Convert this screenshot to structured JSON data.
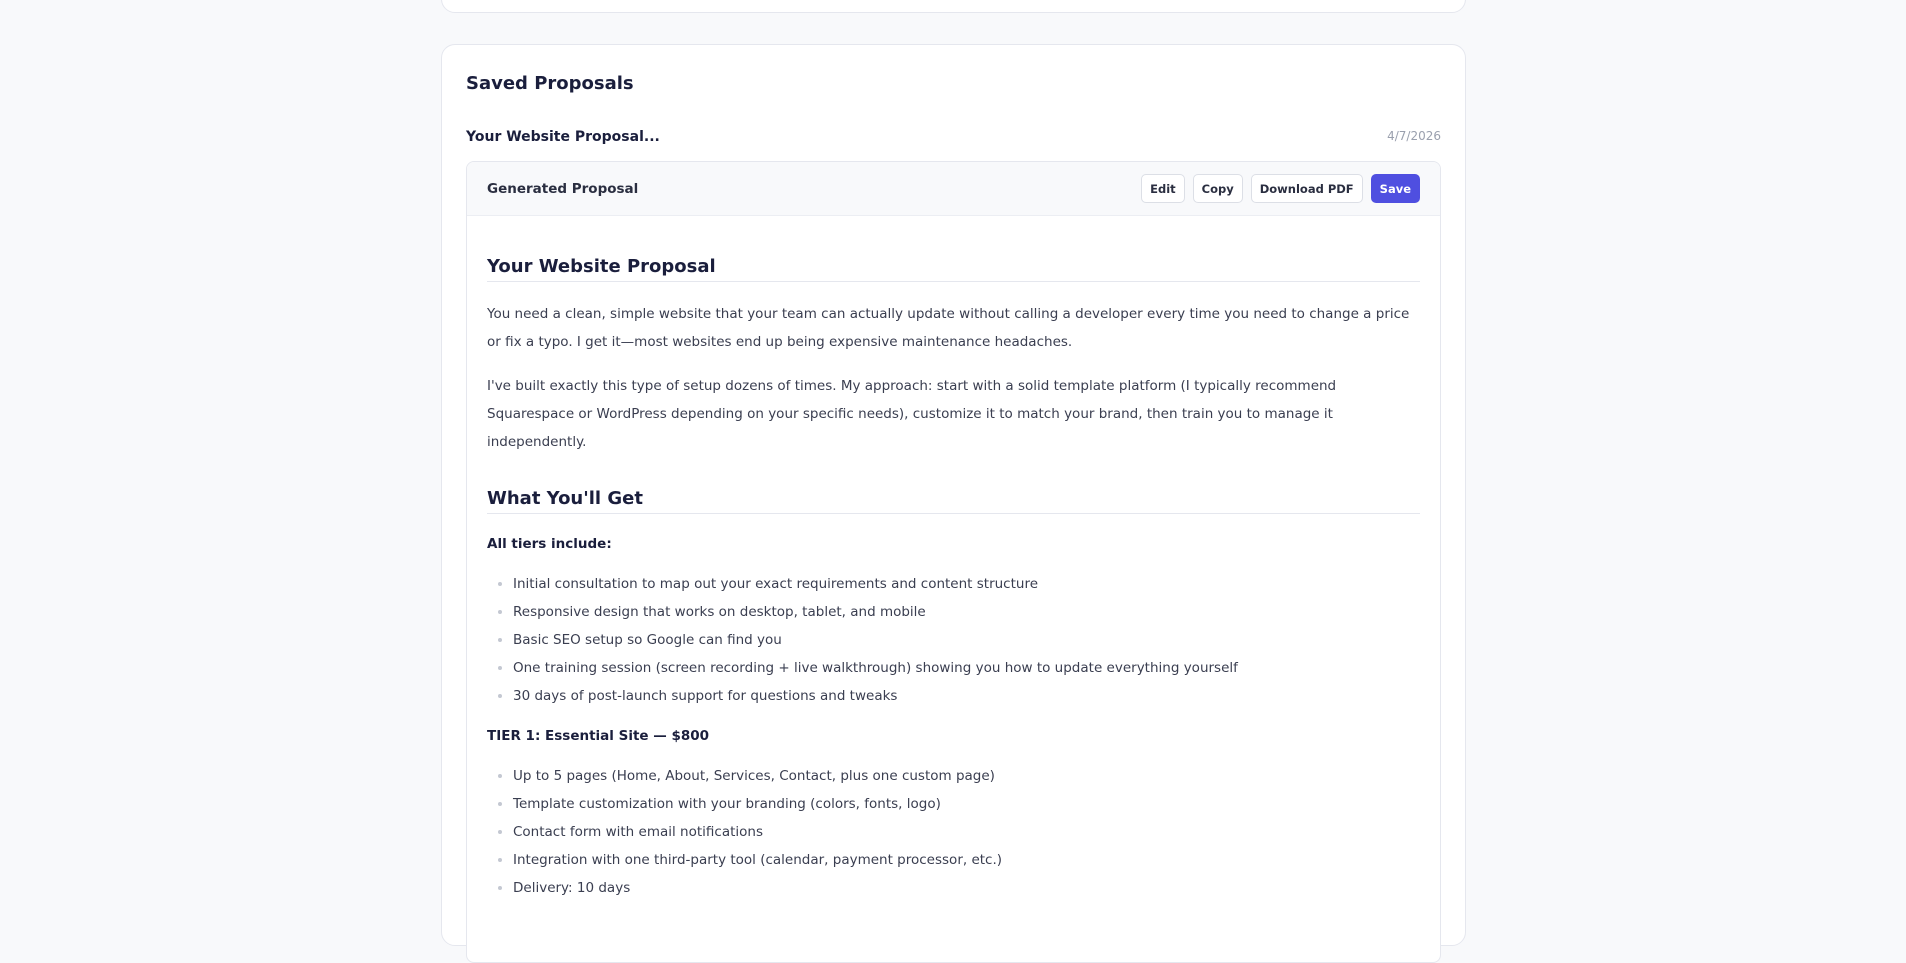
{
  "saved": {
    "title": "Saved Proposals",
    "item": {
      "name": "Your Website Proposal...",
      "date": "4/7/2026"
    }
  },
  "proposal": {
    "header_title": "Generated Proposal",
    "buttons": {
      "edit": "Edit",
      "copy": "Copy",
      "download": "Download PDF",
      "save": "Save"
    },
    "heading1": "Your Website Proposal",
    "para1": "You need a clean, simple website that your team can actually update without calling a developer every time you need to change a price or fix a typo. I get it—most websites end up being expensive maintenance headaches.",
    "para2": "I've built exactly this type of setup dozens of times. My approach: start with a solid template platform (I typically recommend Squarespace or WordPress depending on your specific needs), customize it to match your brand, then train you to manage it independently.",
    "heading2": "What You'll Get",
    "all_tiers_label": "All tiers include:",
    "all_tiers_items": [
      "Initial consultation to map out your exact requirements and content structure",
      "Responsive design that works on desktop, tablet, and mobile",
      "Basic SEO setup so Google can find you",
      "One training session (screen recording + live walkthrough) showing you how to update everything yourself",
      "30 days of post-launch support for questions and tweaks"
    ],
    "tier1_label": "TIER 1: Essential Site — $800",
    "tier1_items": [
      "Up to 5 pages (Home, About, Services, Contact, plus one custom page)",
      "Template customization with your branding (colors, fonts, logo)",
      "Contact form with email notifications",
      "Integration with one third-party tool (calendar, payment processor, etc.)",
      "Delivery: 10 days"
    ]
  }
}
